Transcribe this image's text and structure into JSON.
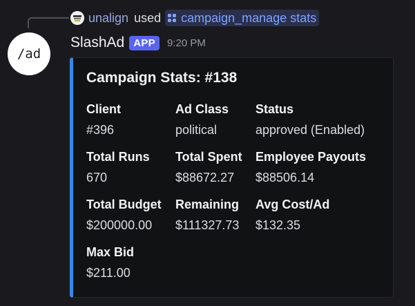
{
  "reply": {
    "user": "unalign",
    "verb": "used",
    "command": "campaign_manage stats"
  },
  "message": {
    "avatar_text": "/ad",
    "username": "SlashAd",
    "badge": "APP",
    "timestamp": "9:20 PM"
  },
  "embed": {
    "accent_color": "#3289ea",
    "title": "Campaign Stats: #138",
    "fields": [
      {
        "name": "Client",
        "value": "#396"
      },
      {
        "name": "Ad Class",
        "value": "political"
      },
      {
        "name": "Status",
        "value": "approved (Enabled)"
      },
      {
        "name": "Total Runs",
        "value": "670"
      },
      {
        "name": "Total Spent",
        "value": "$88672.27"
      },
      {
        "name": "Employee Payouts",
        "value": "$88506.14"
      },
      {
        "name": "Total Budget",
        "value": "$200000.00"
      },
      {
        "name": "Remaining",
        "value": "$111327.73"
      },
      {
        "name": "Avg Cost/Ad",
        "value": "$132.35"
      },
      {
        "name": "Max Bid",
        "value": "$211.00"
      }
    ]
  },
  "icons": {
    "reply_avatar": "user-avatar-icon",
    "command": "slash-command-icon"
  }
}
